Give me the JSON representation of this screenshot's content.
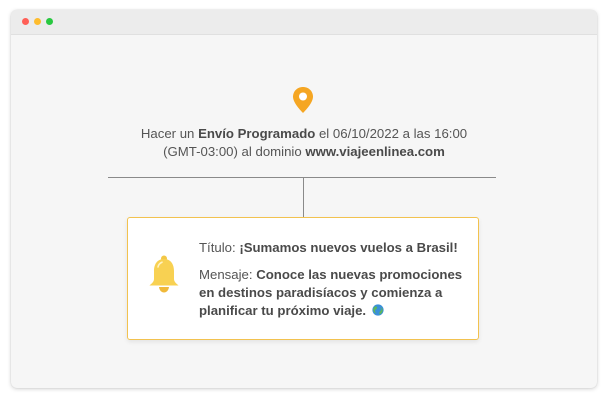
{
  "window": {
    "controls": [
      {
        "name": "close",
        "color": "#ff5f57"
      },
      {
        "name": "minimize",
        "color": "#febc2e"
      },
      {
        "name": "maximize",
        "color": "#28c840"
      }
    ]
  },
  "event": {
    "icon": "location-pin-icon",
    "icon_color": "#f5a623",
    "text_prefix": "Hacer un ",
    "send_type": "Envío Programado",
    "text_date_intro": " el ",
    "date": "06/10/2022",
    "text_time_intro": " a las ",
    "time": "16:00",
    "timezone": "(GMT-03:00)",
    "text_domain_intro": " al dominio ",
    "domain": "www.viajeenlinea.com"
  },
  "notification": {
    "icon": "bell-icon",
    "border_color": "#f2c24f",
    "title_label": "Título: ",
    "title": "¡Sumamos nuevos vuelos a Brasil!",
    "message_label": "Mensaje: ",
    "message": "Conoce las nuevas promociones en destinos paradisíacos y comienza a planificar tu próximo viaje.",
    "message_emoji": "globe-icon"
  }
}
